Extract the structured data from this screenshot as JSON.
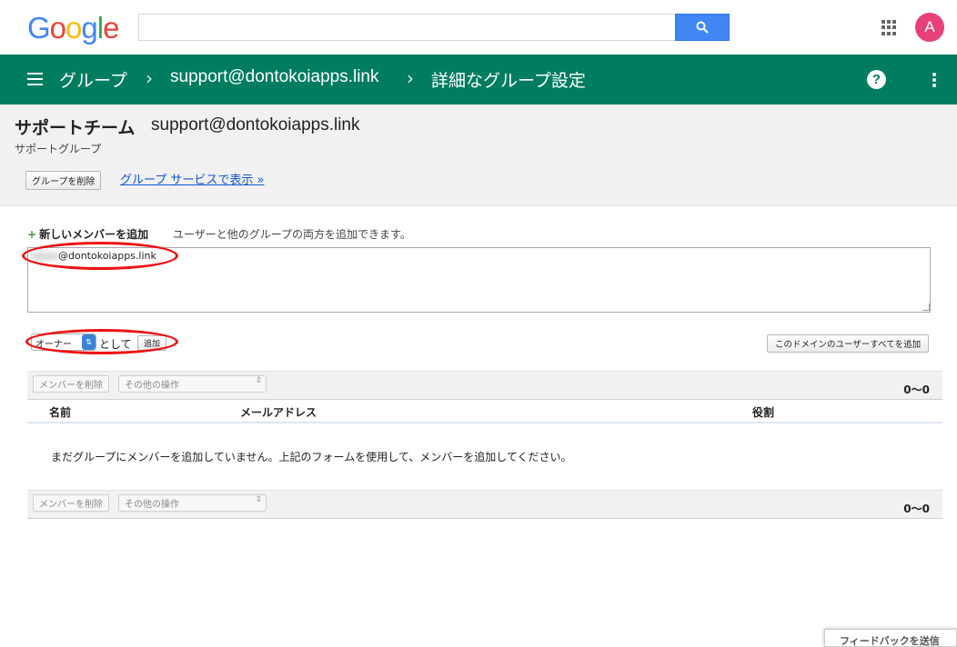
{
  "google_bar": {
    "logo_letters": [
      "G",
      "o",
      "o",
      "g",
      "l",
      "e"
    ],
    "search_value": "",
    "avatar_letter": "A"
  },
  "header": {
    "crumb_groups": "グループ",
    "crumb_group_email": "support@dontokoiapps.link",
    "crumb_current": "詳細なグループ設定",
    "separator": "›",
    "help_label": "?"
  },
  "group": {
    "name": "サポートチーム",
    "email": "support@dontokoiapps.link",
    "description": "サポートグループ",
    "delete_button": "グループを削除",
    "view_link": "グループ サービスで表示 »"
  },
  "add_member": {
    "plus": "+",
    "title": "新しいメンバーを追加",
    "help": "ユーザーと他のグループの両方を追加できます。",
    "input_value": "@dontokoiapps.link",
    "role_selected": "オーナー",
    "as_text": "として",
    "add_button": "追加",
    "add_all_button": "このドメインのユーザーすべてを追加"
  },
  "members": {
    "remove_button": "メンバーを削除",
    "other_actions": "その他の操作",
    "count_top": "0〜0",
    "count_bottom": "0〜0",
    "columns": {
      "name": "名前",
      "email": "メールアドレス",
      "role": "役割"
    },
    "empty_message": "まだグループにメンバーを追加していません。上記のフォームを使用して、メンバーを追加してください。"
  },
  "feedback_button": "フィードバックを送信",
  "colors": {
    "header_green": "#007d61",
    "link_blue": "#1155cc",
    "annotation_red": "#ee1111",
    "avatar_pink": "#e8407a"
  }
}
